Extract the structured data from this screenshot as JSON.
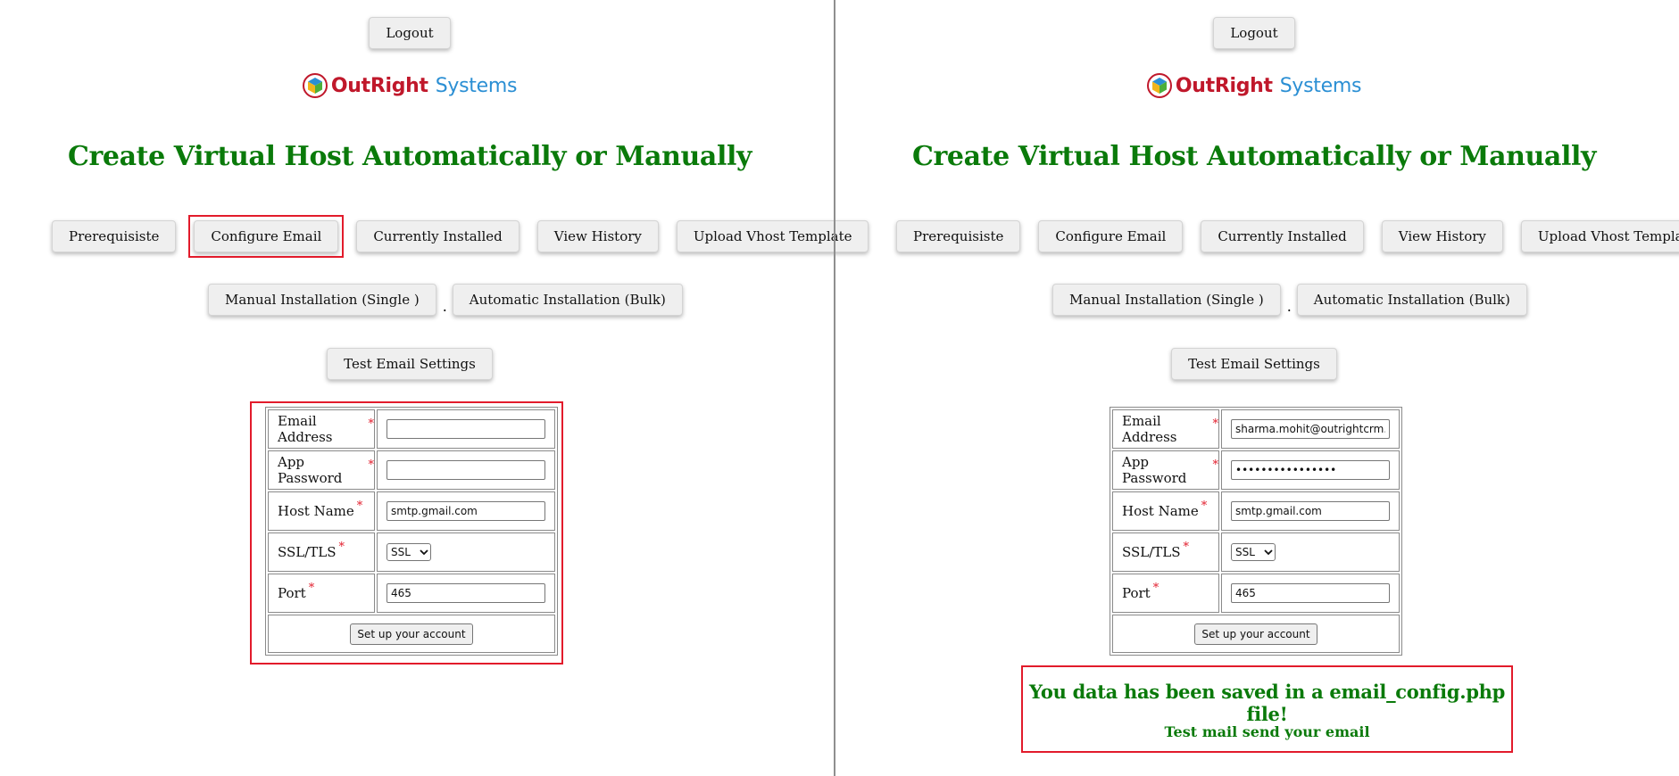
{
  "colors": {
    "title_green": "#0a7a0a",
    "logo_red": "#c0182b",
    "logo_blue": "#2b8fd4",
    "highlight_red": "#e21b2b",
    "button_bg": "#efefef"
  },
  "left": {
    "logout_label": "Logout",
    "logo": {
      "word1": "OutRight",
      "word2": "Systems",
      "icon": "cube-logo-icon"
    },
    "title": "Create Virtual Host Automatically or Manually",
    "nav": {
      "prerequisite": "Prerequisiste",
      "configure_email": "Configure Email",
      "currently_installed": "Currently Installed",
      "view_history": "View History",
      "upload_vhost": "Upload Vhost Template",
      "manual_install": "Manual Installation (Single )",
      "separator": ".",
      "automatic_install": "Automatic Installation (Bulk)"
    },
    "test_email_label": "Test Email Settings",
    "form": {
      "email_label": "Email Address",
      "email_value": "",
      "password_label": "App Password",
      "password_value": "",
      "host_label": "Host Name",
      "host_value": "smtp.gmail.com",
      "ssl_label": "SSL/TLS",
      "ssl_value": "SSL",
      "port_label": "Port",
      "port_value": "465",
      "required_mark": "*",
      "submit_label": "Set up your account"
    }
  },
  "right": {
    "logout_label": "Logout",
    "logo": {
      "word1": "OutRight",
      "word2": "Systems",
      "icon": "cube-logo-icon"
    },
    "title": "Create Virtual Host Automatically or Manually",
    "nav": {
      "prerequisite": "Prerequisiste",
      "configure_email": "Configure Email",
      "currently_installed": "Currently Installed",
      "view_history": "View History",
      "upload_vhost": "Upload Vhost Template",
      "manual_install": "Manual Installation (Single )",
      "separator": ".",
      "automatic_install": "Automatic Installation (Bulk)"
    },
    "test_email_label": "Test Email Settings",
    "form": {
      "email_label": "Email Address",
      "email_value": "sharma.mohit@outrightcrm.c",
      "password_label": "App Password",
      "password_value": "••••••••••••••••",
      "host_label": "Host Name",
      "host_value": "smtp.gmail.com",
      "ssl_label": "SSL/TLS",
      "ssl_value": "SSL",
      "port_label": "Port",
      "port_value": "465",
      "required_mark": "*",
      "submit_label": "Set up your account"
    },
    "message": {
      "saved": "You data has been saved in a email_config.php file!",
      "test_mail": "Test mail send your email"
    }
  }
}
